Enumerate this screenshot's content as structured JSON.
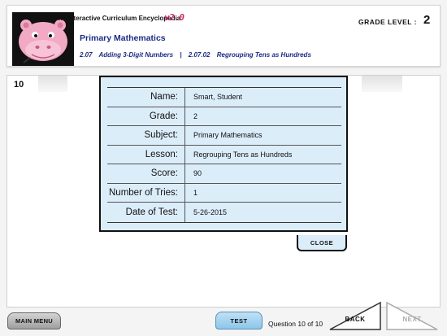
{
  "header": {
    "app_title": "The Interactive Curriculum Encyclopedia",
    "app_version": "v2.0",
    "subject_title": "Primary Mathematics",
    "breadcrumb": {
      "lesson_number": "2.07",
      "lesson_name": "Adding 3-Digit Numbers",
      "separator": "|",
      "sublesson_number": "2.07.02",
      "sublesson_name": "Regrouping Tens as Hundreds"
    },
    "grade_label": "GRADE LEVEL :",
    "grade_value": "2"
  },
  "main": {
    "question_number": "10"
  },
  "results": {
    "rows": [
      {
        "label": "Name:",
        "value": "Smart, Student"
      },
      {
        "label": "Grade:",
        "value": "2"
      },
      {
        "label": "Subject:",
        "value": "Primary Mathematics"
      },
      {
        "label": "Lesson:",
        "value": "Regrouping Tens as Hundreds"
      },
      {
        "label": "Score:",
        "value": "90"
      },
      {
        "label": "Number of Tries:",
        "value": "1"
      },
      {
        "label": "Date of Test:",
        "value": "5-26-2015"
      }
    ],
    "close_label": "CLOSE"
  },
  "footer": {
    "main_menu_label": "MAIN MENU",
    "test_label": "TEST",
    "question_counter": "Question 10 of 10",
    "back_label": "BACK",
    "next_label": "NEXT"
  },
  "colors": {
    "accent_blue": "#1c2b86",
    "version_pink": "#cc2a6b",
    "dialog_bg": "#dcedfa"
  }
}
